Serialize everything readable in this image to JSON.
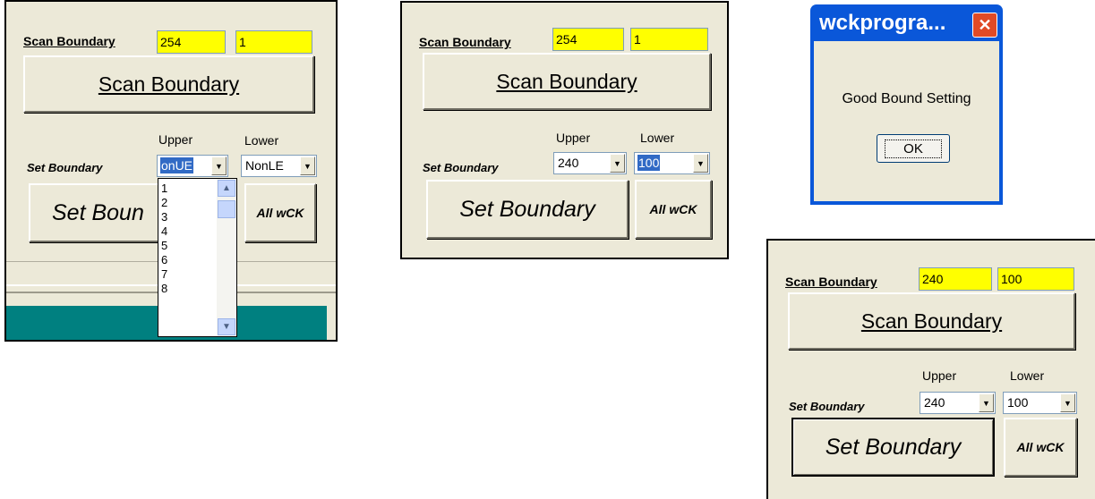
{
  "panel1": {
    "scan_label": "Scan Boundary",
    "upper_value": "254",
    "lower_value": "1",
    "scan_button": "Scan Boundary",
    "upper_header": "Upper",
    "lower_header": "Lower",
    "set_label": "Set Boundary",
    "upper_combo": "onUE",
    "lower_combo": "NonLE",
    "set_button": "Set Boun",
    "all_button": "All wCK",
    "dropdown_items": [
      "1",
      "2",
      "3",
      "4",
      "5",
      "6",
      "7",
      "8"
    ]
  },
  "panel2": {
    "scan_label": "Scan Boundary",
    "upper_value": "254",
    "lower_value": "1",
    "scan_button": "Scan Boundary",
    "upper_header": "Upper",
    "lower_header": "Lower",
    "set_label": "Set Boundary",
    "upper_combo": "240",
    "lower_combo": "100",
    "set_button": "Set Boundary",
    "all_button": "All wCK"
  },
  "dialog": {
    "title": "wckprogra...",
    "message": "Good Bound Setting",
    "ok": "OK"
  },
  "panel3": {
    "scan_label": "Scan Boundary",
    "upper_value": "240",
    "lower_value": "100",
    "scan_button": "Scan Boundary",
    "upper_header": "Upper",
    "lower_header": "Lower",
    "set_label": "Set Boundary",
    "upper_combo": "240",
    "lower_combo": "100",
    "set_button": "Set Boundary",
    "all_button": "All wCK"
  },
  "icons": {
    "dropdown_arrow": "chevron-down-icon",
    "scroll_up": "chevron-up-icon",
    "scroll_down": "chevron-down-icon",
    "close": "close-icon"
  },
  "colors": {
    "field_bg": "#ffff00",
    "panel_bg": "#ece9d8",
    "taskbar": "#008080",
    "title_bar": "#0a57d9",
    "close_button": "#e04a26",
    "selection": "#316ac5"
  }
}
